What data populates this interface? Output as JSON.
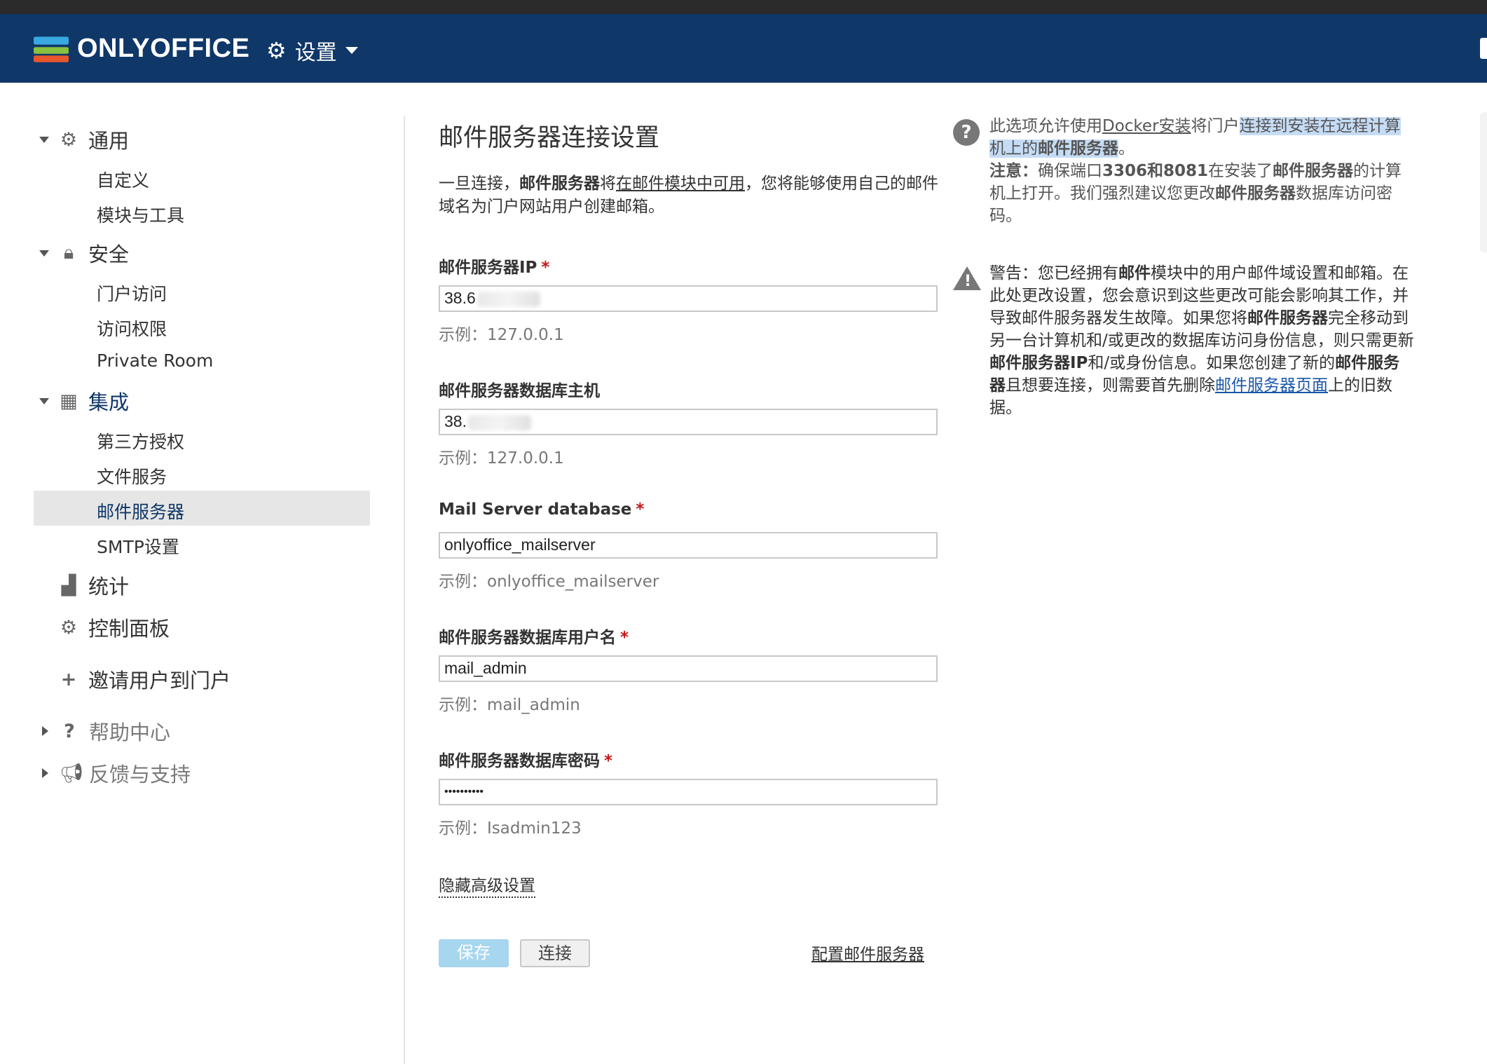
{
  "header": {
    "brand": "ONLYOFFICE",
    "settings_label": "设置"
  },
  "sidebar": {
    "general": {
      "label": "通用",
      "items": [
        "自定义",
        "模块与工具"
      ]
    },
    "security": {
      "label": "安全",
      "items": [
        "门户访问",
        "访问权限",
        "Private Room"
      ]
    },
    "integration": {
      "label": "集成",
      "items": [
        "第三方授权",
        "文件服务",
        "邮件服务器",
        "SMTP设置"
      ]
    },
    "statistics": "统计",
    "control_panel": "控制面板",
    "invite": "邀请用户到门户",
    "help": "帮助中心",
    "feedback": "反馈与支持"
  },
  "main": {
    "title": "邮件服务器连接设置",
    "intro": {
      "p1": "一旦连接，",
      "b1": "邮件服务器",
      "p2": "将",
      "link": "在邮件模块中可用",
      "p3": "，您将能够使用自己的邮件域名为门户网站用户创建邮箱。"
    },
    "fields": [
      {
        "label": "邮件服务器IP",
        "value": "38.6",
        "hint": "示例：127.0.0.1"
      },
      {
        "label": "邮件服务器数据库主机",
        "value": "38.",
        "hint": "示例：127.0.0.1"
      },
      {
        "label": "Mail Server database",
        "value": "onlyoffice_mailserver",
        "hint": "示例：onlyoffice_mailserver"
      },
      {
        "label": "邮件服务器数据库用户名",
        "value": "mail_admin",
        "hint": "示例：mail_admin"
      },
      {
        "label": "邮件服务器数据库密码",
        "value": "••••••••••",
        "hint": "示例：Isadmin123"
      }
    ],
    "required_mark": "*",
    "advanced_link": "隐藏高级设置",
    "save_button": "保存",
    "connect_button": "连接",
    "configure_link": "配置邮件服务器"
  },
  "help": {
    "t1": "此选项允许使用",
    "docker_link": "Docker安装",
    "t2": "将门户",
    "hl1": "连接到安装在远程计算机上的",
    "hl2": "邮件服务器",
    "t3": "。",
    "note_label": "注意：",
    "t4": "确保端口",
    "ports": "3306和8081",
    "t5": "在安装了",
    "b_ms": "邮件服务器",
    "t6": "的计算机上打开。我们强烈建议您更改",
    "b_ms2": "邮件服务器",
    "t7": "数据库访问密码。"
  },
  "warning": {
    "w1": "警告：您已经拥有",
    "b1": "邮件",
    "w2": "模块中的用户邮件域设置和邮箱。在此处更改设置，您会意识到这些更改可能会影响其工作，并导致邮件服务器发生故障。如果您将",
    "b2": "邮件服务器",
    "w3": "完全移动到另一台计算机和/或更改的数据库访问身份信息，则只需更新",
    "b3": "邮件服务器IP",
    "w4": "和/或身份信息。如果您创建了新的",
    "b4": "邮件服务器",
    "w5": "且想要连接，则需要首先删除",
    "link": "邮件服务器页面",
    "w6": "上的旧数据。"
  }
}
